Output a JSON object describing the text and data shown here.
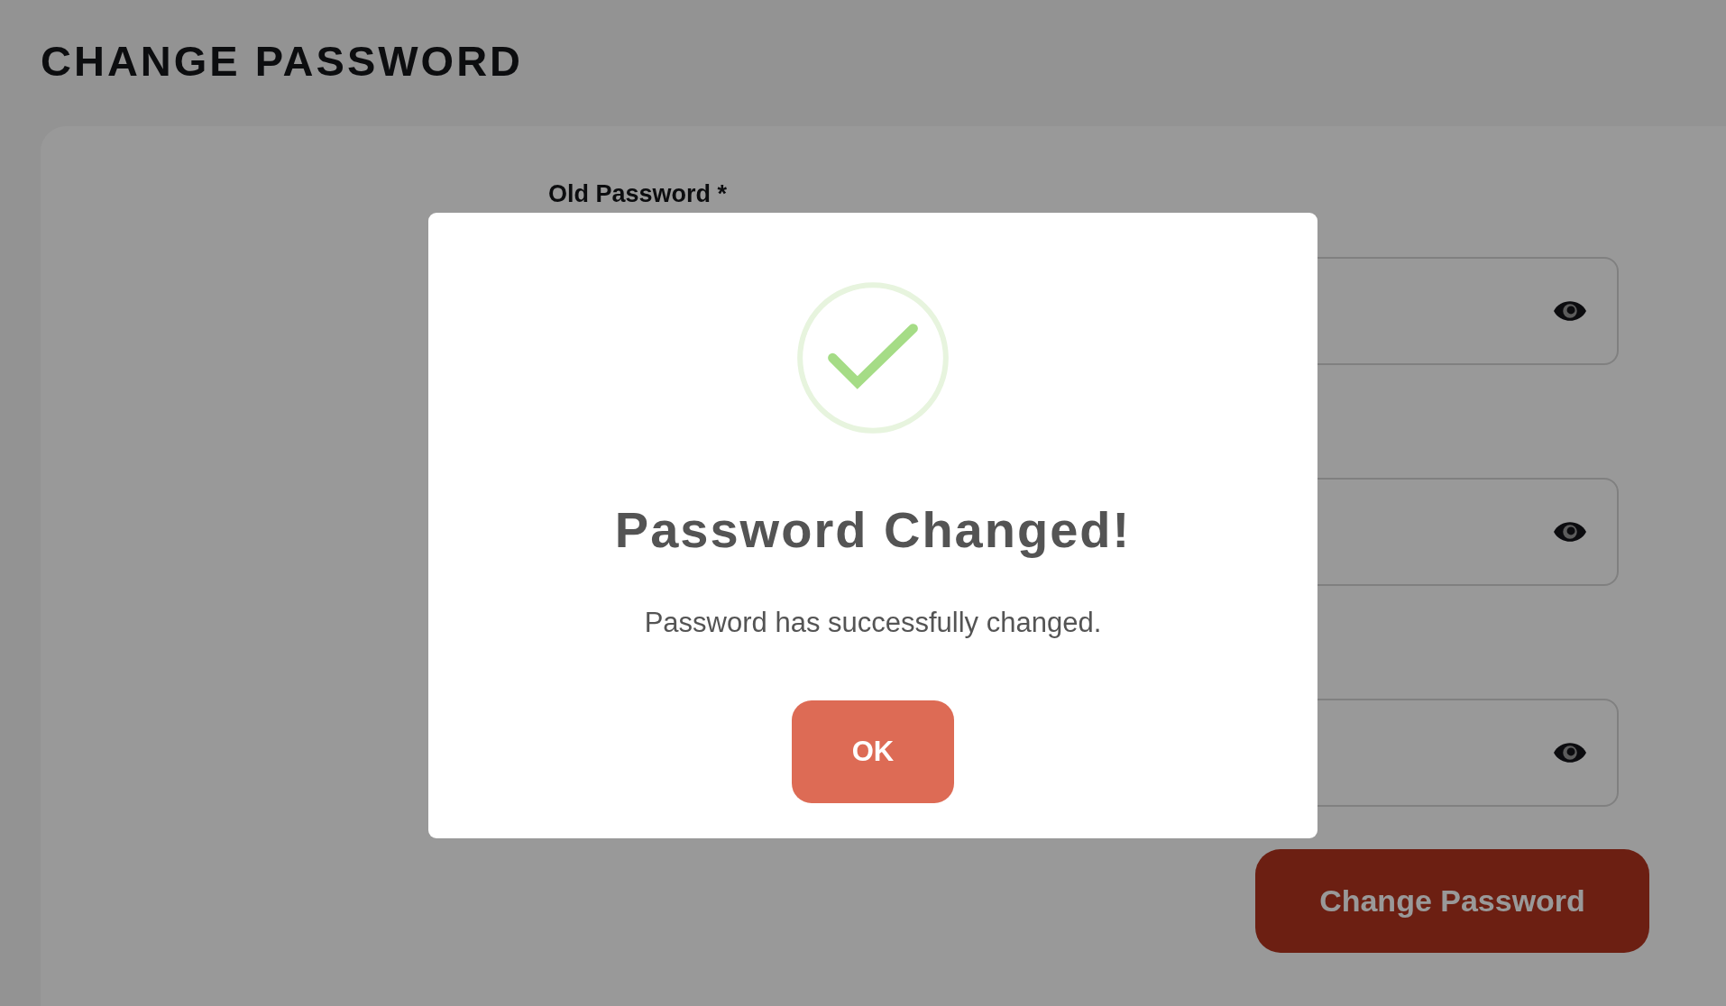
{
  "page": {
    "title": "CHANGE PASSWORD"
  },
  "fields": [
    {
      "label": "Old Password *",
      "masked": true
    },
    {
      "masked": true
    },
    {
      "masked": true
    }
  ],
  "submit_button": {
    "label": "Change Password"
  },
  "dialog": {
    "kind": "success",
    "title": "Password Changed!",
    "message": "Password has successfully changed.",
    "button": "OK"
  }
}
